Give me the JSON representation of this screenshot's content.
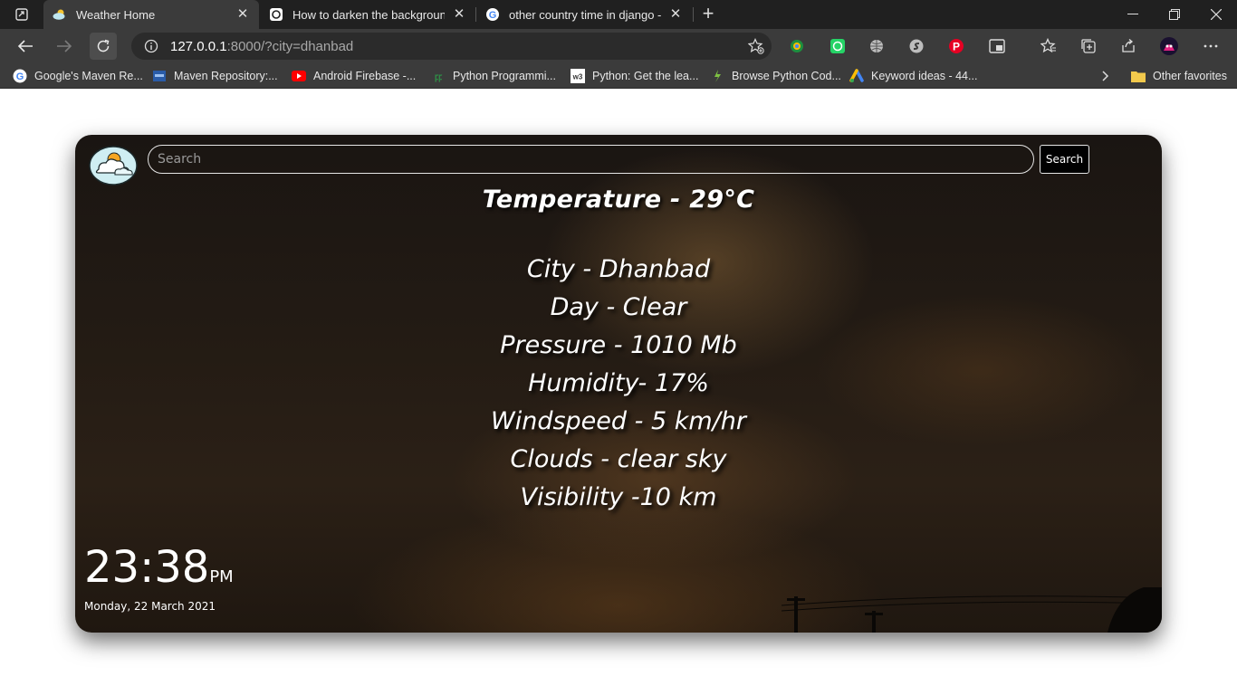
{
  "browser": {
    "tabs": [
      {
        "title": "Weather Home",
        "active": true
      },
      {
        "title": "How to darken the background i"
      },
      {
        "title": "other country time in django - G"
      }
    ],
    "url_host": "127.0.0.1",
    "url_rest": ":8000/?city=dhanbad",
    "bookmarks": [
      {
        "label": "Google's Maven Re...",
        "icon": "google-icon"
      },
      {
        "label": "Maven Repository:...",
        "icon": "maven-icon"
      },
      {
        "label": "Android Firebase -...",
        "icon": "youtube-icon"
      },
      {
        "label": "Python Programmi...",
        "icon": "gfg-icon"
      },
      {
        "label": "Python: Get the lea...",
        "icon": "w3schools-icon"
      },
      {
        "label": "Browse Python Cod...",
        "icon": "code-icon"
      },
      {
        "label": "Keyword ideas - 44...",
        "icon": "google-ads-icon"
      }
    ],
    "other_favorites": "Other favorites"
  },
  "page": {
    "search_placeholder": "Search",
    "search_button": "Search",
    "temperature": "Temperature - 29°C",
    "stats": [
      "City - Dhanbad",
      "Day - Clear",
      "Pressure - 1010 Mb",
      "Humidity- 17%",
      "Windspeed - 5 km/hr",
      "Clouds - clear sky",
      "Visibility -10 km"
    ],
    "time": "23:38",
    "ampm": "PM",
    "date": "Monday, 22 March 2021"
  }
}
